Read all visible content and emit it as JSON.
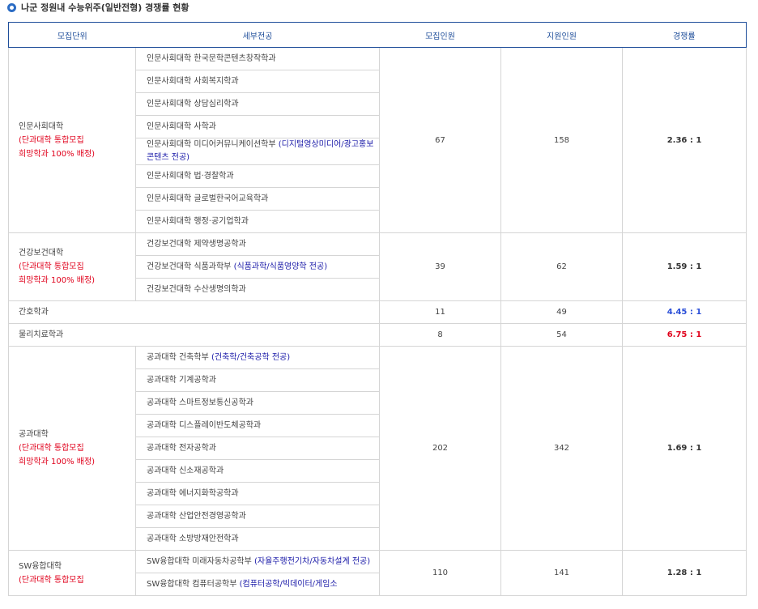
{
  "title": "나군 정원내 수능위주(일반전형) 경쟁률 현황",
  "headers": [
    "모집단위",
    "세부전공",
    "모집인원",
    "지원인원",
    "경쟁률"
  ],
  "groups": [
    {
      "unit": "인문사회대학",
      "note1": "(단과대학 통합모집",
      "note2": "희망학과 100% 배정)",
      "majors": [
        {
          "name": "인문사회대학 한국문학콘텐츠창작학과",
          "detail": ""
        },
        {
          "name": "인문사회대학 사회복지학과",
          "detail": ""
        },
        {
          "name": "인문사회대학 상담심리학과",
          "detail": ""
        },
        {
          "name": "인문사회대학 사학과",
          "detail": ""
        },
        {
          "name": "인문사회대학 미디어커뮤니케이션학부 ",
          "detail": "(디지털영상미디어/광고홍보콘텐츠 전공)"
        },
        {
          "name": "인문사회대학 법·경찰학과",
          "detail": ""
        },
        {
          "name": "인문사회대학 글로벌한국어교육학과",
          "detail": ""
        },
        {
          "name": "인문사회대학 행정·공기업학과",
          "detail": ""
        }
      ],
      "quota": "67",
      "applicants": "158",
      "rate": "2.36 : 1"
    },
    {
      "unit": "건강보건대학",
      "note1": "(단과대학 통합모집",
      "note2": "희망학과 100% 배정)",
      "majors": [
        {
          "name": "건강보건대학 제약생명공학과",
          "detail": ""
        },
        {
          "name": "건강보건대학 식품과학부 ",
          "detail": "(식품과학/식품영양학 전공)"
        },
        {
          "name": "건강보건대학 수산생명의학과",
          "detail": ""
        }
      ],
      "quota": "39",
      "applicants": "62",
      "rate": "1.59 : 1"
    }
  ],
  "singles": [
    {
      "unit": "간호학과",
      "quota": "11",
      "applicants": "49",
      "rate": "4.45 : 1",
      "rate_color": "#2b4fd8"
    },
    {
      "unit": "물리치료학과",
      "quota": "8",
      "applicants": "54",
      "rate": "6.75 : 1",
      "rate_color": "#e0001b"
    }
  ],
  "groups2": [
    {
      "unit": "공과대학",
      "note1": "(단과대학 통합모집",
      "note2": "희망학과 100% 배정)",
      "majors": [
        {
          "name": "공과대학 건축학부 ",
          "detail": "(건축학/건축공학 전공)"
        },
        {
          "name": "공과대학 기계공학과",
          "detail": ""
        },
        {
          "name": "공과대학 스마트정보통신공학과",
          "detail": ""
        },
        {
          "name": "공과대학 디스플레이반도체공학과",
          "detail": ""
        },
        {
          "name": "공과대학 전자공학과",
          "detail": ""
        },
        {
          "name": "공과대학 신소재공학과",
          "detail": ""
        },
        {
          "name": "공과대학 에너지화학공학과",
          "detail": ""
        },
        {
          "name": "공과대학 산업안전경영공학과",
          "detail": ""
        },
        {
          "name": "공과대학 소방방재안전학과",
          "detail": ""
        }
      ],
      "quota": "202",
      "applicants": "342",
      "rate": "1.69 : 1"
    },
    {
      "unit": "SW융합대학",
      "note1": "(단과대학 통합모집",
      "note2": "",
      "majors": [
        {
          "name": "SW융합대학 미래자동차공학부 ",
          "detail": "(자율주행전기차/자동차설계 전공)"
        },
        {
          "name": "SW융합대학 컴퓨터공학부 ",
          "detail": "(컴퓨터공학/빅데이터/게임소"
        }
      ],
      "quota": "110",
      "applicants": "141",
      "rate": "1.28 : 1"
    }
  ]
}
